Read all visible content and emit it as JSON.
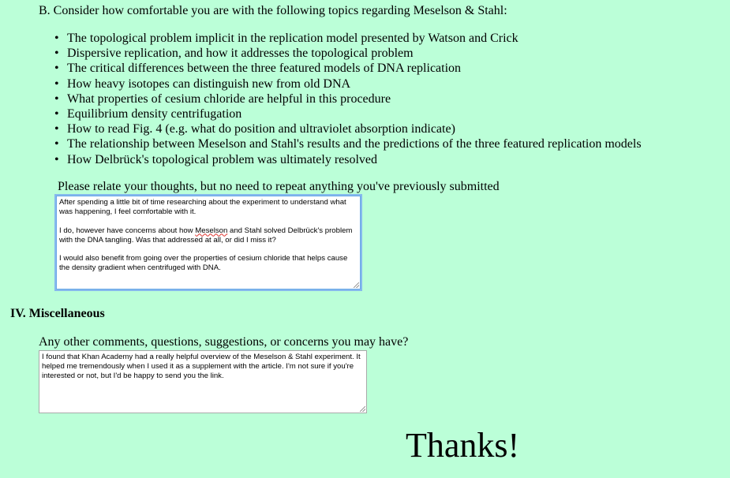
{
  "section_b": {
    "heading": "B. Consider how comfortable you are with the following topics regarding Meselson & Stahl:",
    "topics": [
      "The topological problem implicit in the replication model presented by Watson and Crick",
      "Dispersive replication, and how it addresses the topological problem",
      "The critical differences between the three featured models of DNA replication",
      "How heavy isotopes can distinguish new from old DNA",
      "What properties of cesium chloride are helpful in this procedure",
      "Equilibrium density centrifugation",
      "How to read Fig. 4 (e.g. what do position and ultraviolet absorption indicate)",
      "The relationship between Meselson and Stahl's results and the predictions of the three featured replication models",
      "How Delbrück's topological problem was ultimately resolved"
    ],
    "relate_prompt": "Please relate your thoughts, but no need to repeat anything you've previously submitted",
    "thoughts_response": {
      "p1": "After spending a little bit of time researching about the experiment to understand what was happening, I feel comfortable with it.",
      "p2_before": "I do, however have concerns about how ",
      "p2_misspelled": "Meselson",
      "p2_after": " and Stahl solved Delbrück's problem with the DNA tangling. Was that addressed at all, or did I miss it?",
      "p3": "I would also benefit from going over the properties of cesium chloride that helps cause the density gradient when centrifuged with DNA."
    }
  },
  "miscellaneous": {
    "heading": "IV. Miscellaneous",
    "prompt": "Any other comments, questions, suggestions, or concerns you may have?",
    "response": "I found that Khan Academy had a really helpful overview of the Meselson & Stahl experiment. It helped me tremendously when I used it as a supplement with the article. I'm not sure if you're interested or not, but I'd be happy to send you the link."
  },
  "closing": {
    "thanks": "Thanks!"
  },
  "icons": {
    "bullet": "•"
  }
}
